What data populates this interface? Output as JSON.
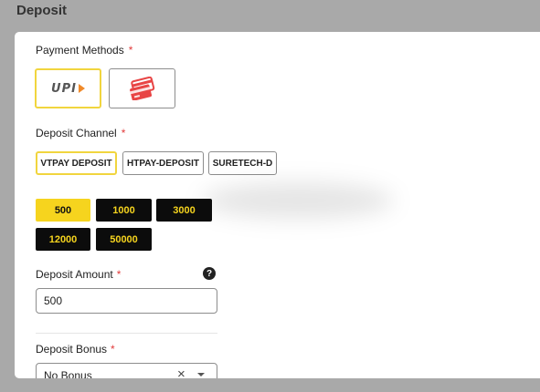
{
  "page": {
    "title": "Deposit"
  },
  "payment_methods": {
    "label": "Payment Methods",
    "required_mark": "*",
    "options": [
      {
        "name": "UPI",
        "logo_text": "UPI",
        "selected": true
      },
      {
        "name": "Card",
        "icon": "credit-card-icon",
        "selected": false
      }
    ]
  },
  "deposit_channel": {
    "label": "Deposit Channel",
    "required_mark": "*",
    "options": [
      {
        "label": "VTPAY DEPOSIT",
        "selected": true
      },
      {
        "label": "HTPAY-DEPOSIT",
        "selected": false
      },
      {
        "label": "SURETECH-D",
        "selected": false
      }
    ]
  },
  "quick_amounts": {
    "options": [
      {
        "label": "500",
        "selected": true
      },
      {
        "label": "1000",
        "selected": false
      },
      {
        "label": "3000",
        "selected": false
      },
      {
        "label": "12000",
        "selected": false
      },
      {
        "label": "50000",
        "selected": false
      }
    ]
  },
  "deposit_amount": {
    "label": "Deposit Amount",
    "required_mark": "*",
    "value": "500",
    "help_icon": "question-circle-icon",
    "help_glyph": "?"
  },
  "deposit_bonus": {
    "label": "Deposit Bonus",
    "required_mark": "*",
    "value": "No Bonus",
    "clear_glyph": "×"
  },
  "colors": {
    "accent_yellow": "#f6d41e",
    "chip_black": "#0c0c0c",
    "required_red": "#e23b3b",
    "overlay_gray": "#a9a9a9"
  }
}
